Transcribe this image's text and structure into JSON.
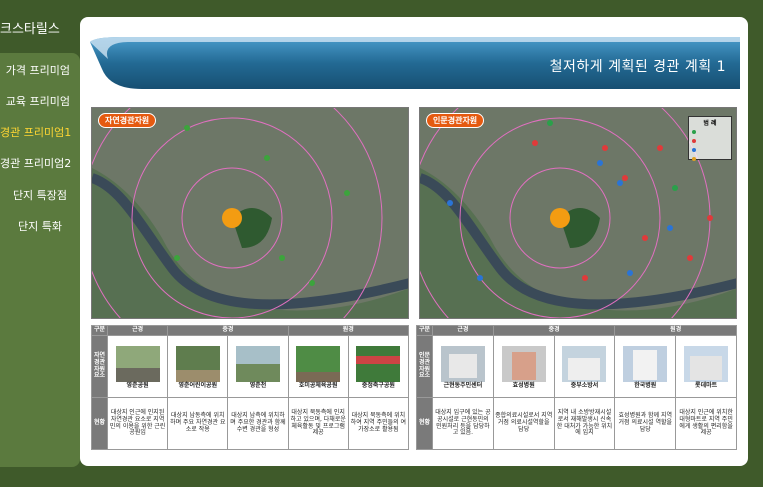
{
  "sidebar": {
    "title": "크스타릴스",
    "items": [
      {
        "label": "가격 프리미엄"
      },
      {
        "label": "교육 프리미엄"
      },
      {
        "label": "경관 프리미엄1"
      },
      {
        "label": "경관 프리미엄2"
      },
      {
        "label": "단지 특장점"
      },
      {
        "label": "단지 특화"
      }
    ]
  },
  "banner": {
    "title": "철저하게 계획된 경관 계획 1"
  },
  "left": {
    "map_label": "자연경관자원",
    "table": {
      "headers": [
        "구분",
        "근경",
        "중경",
        "원경"
      ],
      "row_label_visual": "자연\n경관\n자원\n요소",
      "row_label_status": "현황",
      "captions": [
        "영춘공원",
        "영춘어린이공원",
        "영춘천",
        "호미공체육공원",
        "중정축구공원"
      ],
      "descriptions": [
        "대상지 인근에 인지된 자연경관 요소로 지역민의 이용을 위한 근린 공원임",
        "대상지 남동측에 위치하며 주요 자연경관 요소로 작용",
        "대상지 남측에 위치하며 주요한 경관과 함께 수변 경관을 형성",
        "대상지 북동측에 인지하고 있으며, 다채로운 체육활동 및 프로그램 제공",
        "대상지 북동측에 위치하여 지역 주민들의 여가장소로 활용됨"
      ]
    }
  },
  "right": {
    "map_label": "인문경관자원",
    "legend_title": "범 례",
    "table": {
      "headers": [
        "구분",
        "근경",
        "중경",
        "원경"
      ],
      "row_label_visual": "인문\n경관\n자원\n요소",
      "row_label_status": "현황",
      "captions": [
        "근현동주민센터",
        "효성병원",
        "중부소방서",
        "한국병원",
        "롯데마트"
      ],
      "descriptions": [
        "대상지 입구에 있는 공공시설로 근현동민의 민원처리 등을 담당하고 있음.",
        "종합의료시설로서 지역거점 의료시설역할을 담당",
        "지역 내 소방방재시설로서 재해발생시 신속한 대처가 가능한 위치에 입지",
        "효성병원과 함께 지역거점 의료시설 역할을 담당",
        "대상지 인근에 위치한 대형마트로 지역 주민에게 생활의 편리함을 제공"
      ]
    }
  },
  "colors": {
    "background": "#3f5a2a",
    "sidebar": "#5b7a3e",
    "active_menu": "#ffd633",
    "banner": "#2a6e96",
    "label": "#e55a10"
  }
}
